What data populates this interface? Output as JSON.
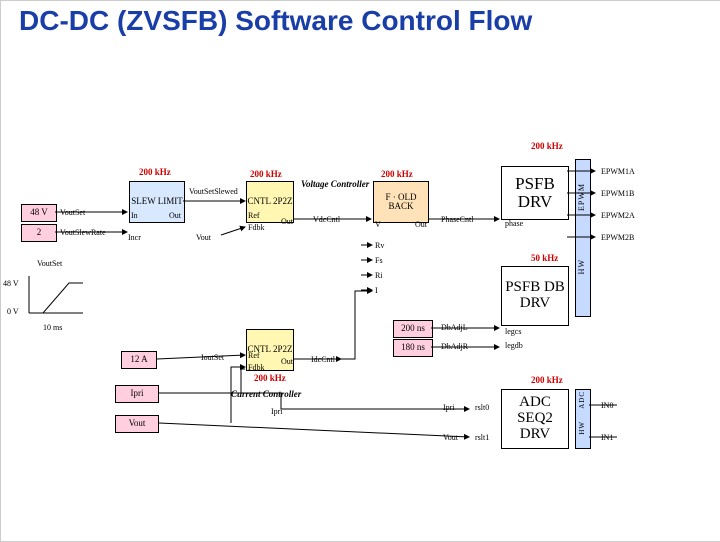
{
  "title": "DC-DC (ZVSFB) Software Control Flow",
  "rates": {
    "slew": "200 kHz",
    "cntl_v": "200 kHz",
    "phase": "200 kHz",
    "top": "200 kHz",
    "db": "50 kHz",
    "cntl_i": "200 kHz",
    "adc": "200 kHz"
  },
  "inputs": {
    "v48": "48 V",
    "slewrate": "2",
    "i12": "12 A",
    "ipri": "Ipri",
    "vout": "Vout",
    "dbL": "200 ns",
    "dbR": "180 ns"
  },
  "blocks": {
    "slew": "SLEW\nLIMIT",
    "cntl_v": "CNTL\n2P2Z",
    "cntl_i": "CNTL\n2P2Z",
    "voltage_ctrl": "Voltage\nController",
    "current_ctrl": "Current Controller",
    "back": "F · OLD\nBACK",
    "psfb_drv": "PSFB\nDRV",
    "psfb_db": "PSFB\nDB\nDRV",
    "adc": "ADC\nSEQ2\nDRV"
  },
  "sig": {
    "voutset": "VoutSet",
    "voutsetslewed": "VoutSetSlewed",
    "voutslewrate": "VoutSlewRate",
    "in": "In",
    "out": "Out",
    "incr": "Incr",
    "vout": "Vout",
    "ref": "Ref",
    "fdbk": "Fdbk",
    "vdccntl": "VdcCntl",
    "idccntl": "IdcCntl",
    "ioutset": "IoutSet",
    "ipri": "Ipri",
    "v": "V",
    "rv": "Rv",
    "fs": "Fs",
    "ri": "Ri",
    "i": "I",
    "phasecntl": "PhaseCntl",
    "phase": "phase",
    "dbadjL": "DbAdjL",
    "dbadjR": "DbAdjR",
    "legcs": "legcs",
    "legdb": "legdb",
    "rslt0": "rslt0",
    "rslt1": "rslt1",
    "in0": "IN0",
    "in1": "IN1",
    "epwm1a": "EPWM1A",
    "epwm1b": "EPWM1B",
    "epwm2a": "EPWM2A",
    "epwm2b": "EPWM2B",
    "adc_v": "ADC",
    "hw_v": "HW",
    "epwm_v": "EPWM",
    "hw_v2": "HW"
  },
  "axis": {
    "v48": "48 V",
    "v0": "0 V",
    "t10": "10 ms",
    "voutset": "VoutSet"
  }
}
